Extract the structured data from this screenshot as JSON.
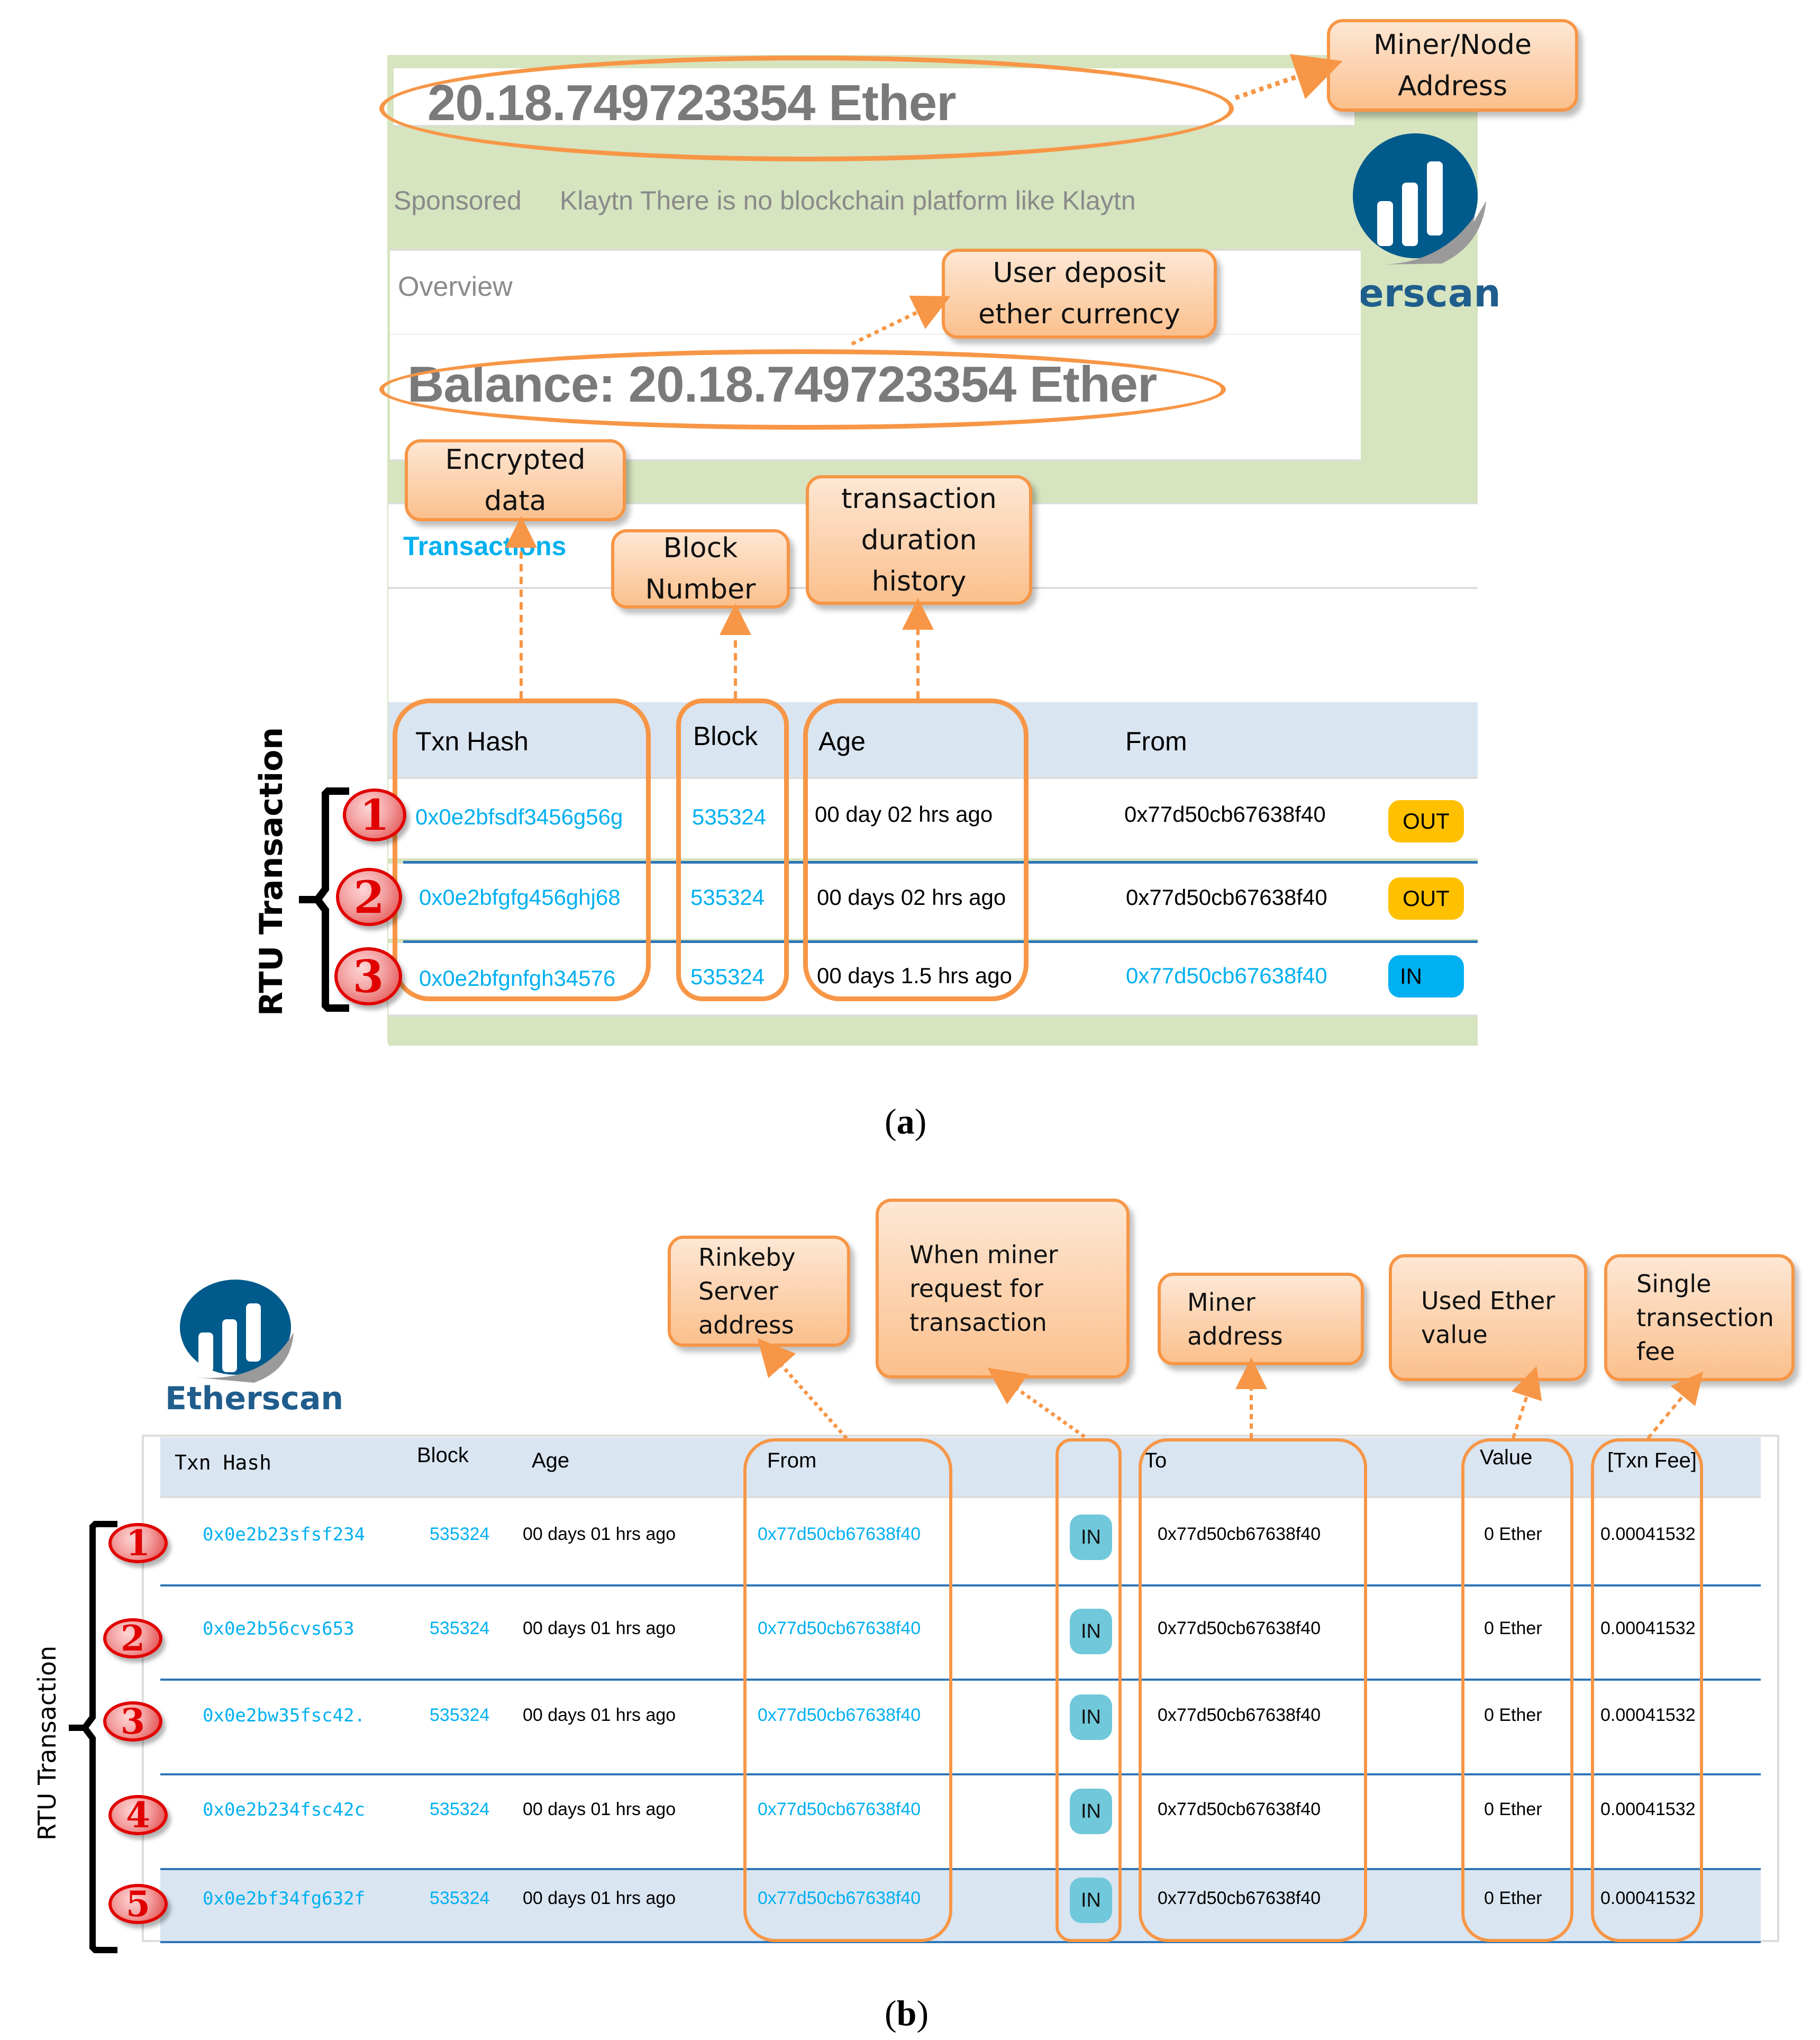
{
  "panel_a": {
    "top_amount": "20.18.749723354 Ether",
    "sponsored_label": "Sponsored",
    "sponsored_text": "Klaytn There is no blockchain platform like Klaytn",
    "overview_label": "Overview",
    "balance_text": "Balance:  20.18.749723354 Ether",
    "transactions_tab": "Transactions",
    "logo_text": "Etherscan",
    "table": {
      "headers": [
        "Txn Hash",
        "Block",
        "Age",
        "From"
      ],
      "rows": [
        {
          "number": "1",
          "hash": "0x0e2bfsdf3456g56g",
          "block": "535324",
          "age": "00 day 02 hrs ago",
          "from": "0x77d50cb67638f40",
          "direction": "OUT"
        },
        {
          "number": "2",
          "hash": "0x0e2bfgfg456ghj68",
          "block": "535324",
          "age": "00 days 02 hrs ago",
          "from": "0x77d50cb67638f40",
          "direction": "OUT"
        },
        {
          "number": "3",
          "hash": "0x0e2bfgnfgh34576",
          "block": "535324",
          "age": "00 days 1.5 hrs ago",
          "from": "0x77d50cb67638f40",
          "direction": "IN"
        }
      ]
    },
    "callouts": {
      "miner_node": "Miner/Node\nAddress",
      "user_deposit": "User deposit\nether currency",
      "encrypted": "Encrypted\ndata",
      "block_number": "Block\nNumber",
      "duration": "transaction\nduration\nhistory"
    },
    "brace_label": "RTU Transaction",
    "caption_letter": "a"
  },
  "panel_b": {
    "logo_text": "Etherscan",
    "table": {
      "headers": [
        "Txn Hash",
        "Block",
        "Age",
        "From",
        "To",
        "Value",
        "[Txn Fee]"
      ],
      "rows": [
        {
          "number": "1",
          "hash": "0x0e2b23sfsf234",
          "block": "535324",
          "age": "00 days 01 hrs ago",
          "from": "0x77d50cb67638f40",
          "direction": "IN",
          "to": "0x77d50cb67638f40",
          "value": "0 Ether",
          "fee": "0.00041532"
        },
        {
          "number": "2",
          "hash": "0x0e2b56cvs653",
          "block": "535324",
          "age": "00 days 01 hrs ago",
          "from": "0x77d50cb67638f40",
          "direction": "IN",
          "to": "0x77d50cb67638f40",
          "value": "0 Ether",
          "fee": "0.00041532"
        },
        {
          "number": "3",
          "hash": "0x0e2bw35fsc42.",
          "block": "535324",
          "age": "00 days 01 hrs ago",
          "from": "0x77d50cb67638f40",
          "direction": "IN",
          "to": "0x77d50cb67638f40",
          "value": "0 Ether",
          "fee": "0.00041532"
        },
        {
          "number": "4",
          "hash": "0x0e2b234fsc42c",
          "block": "535324",
          "age": "00 days 01 hrs ago",
          "from": "0x77d50cb67638f40",
          "direction": "IN",
          "to": "0x77d50cb67638f40",
          "value": "0 Ether",
          "fee": "0.00041532"
        },
        {
          "number": "5",
          "hash": "0x0e2bf34fg632f",
          "block": "535324",
          "age": "00 days 01 hrs ago",
          "from": "0x77d50cb67638f40",
          "direction": "IN",
          "to": "0x77d50cb67638f40",
          "value": "0 Ether",
          "fee": "0.00041532"
        }
      ]
    },
    "callouts": {
      "rinkeby": "Rinkeby\nServer\naddress",
      "when_miner": "When        miner\nrequest         for\ntransaction",
      "miner_address": "Miner\naddress",
      "used_ether": "Used    Ether\nvalue",
      "single_fee": "Single\ntransection\nfee"
    },
    "brace_label": "RTU Transaction",
    "caption_letter": "b"
  },
  "colors": {
    "accent_orange": "#f79646",
    "link_blue": "#00b0f0",
    "out_badge": "#ffc000",
    "in_badge_a": "#00b0f0",
    "in_badge_b": "#70c8da",
    "header_bg": "#d9e5f1",
    "panel_green": "#d6e4bf",
    "logo_blue": "#005a8c"
  }
}
